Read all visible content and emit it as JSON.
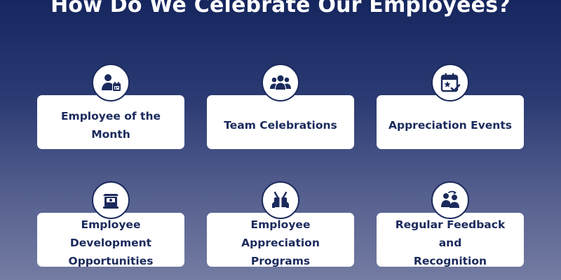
{
  "title": "How Do We Celebrate Our Employees?",
  "colors": {
    "navy": "#1b2a5c",
    "card": "#ffffff",
    "gradient_top": "#16265e",
    "gradient_bottom": "#747ca2"
  },
  "cards": [
    {
      "label_line1": "Employee of the",
      "label_line2": "Month",
      "icon": "employee-calendar-icon"
    },
    {
      "label_line1": "Team Celebrations",
      "label_line2": "",
      "icon": "team-group-icon"
    },
    {
      "label_line1": "Appreciation Events",
      "label_line2": "",
      "icon": "calendar-star-check-icon"
    },
    {
      "label_line1": "Employee Development",
      "label_line2": "Opportunities",
      "icon": "development-podium-icon"
    },
    {
      "label_line1": "Employee Appreciation",
      "label_line2": "Programs",
      "icon": "appreciation-gift-icon"
    },
    {
      "label_line1": "Regular Feedback and",
      "label_line2": "Recognition",
      "icon": "feedback-people-icon"
    }
  ]
}
